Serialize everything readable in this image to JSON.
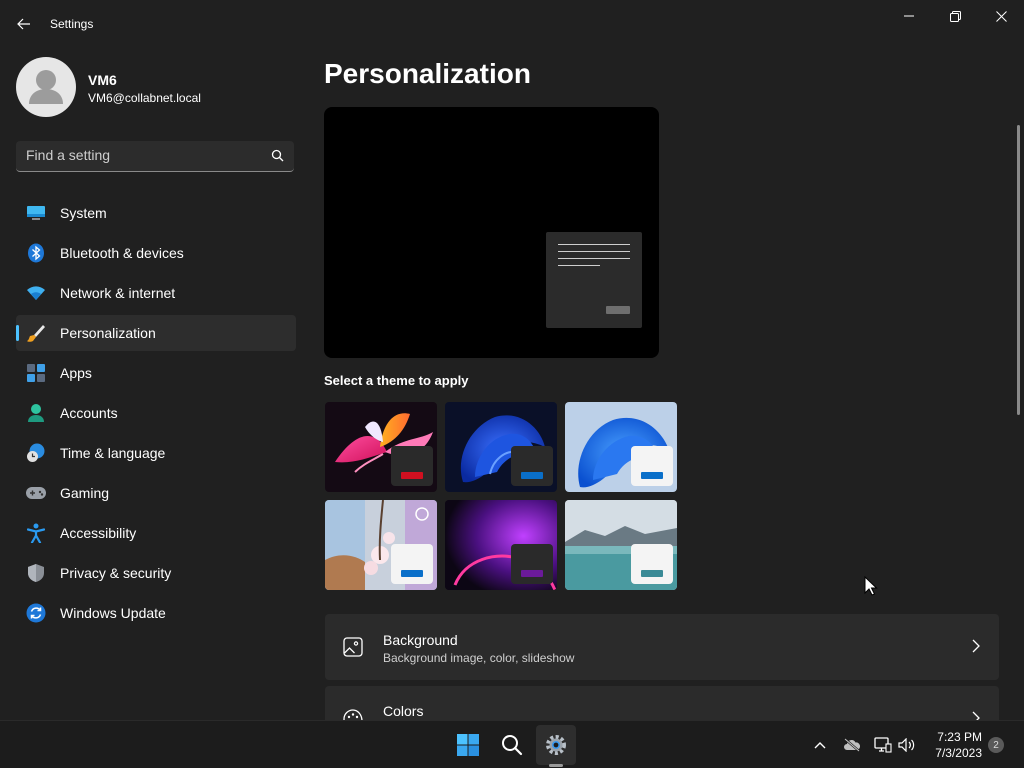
{
  "window": {
    "title": "Settings"
  },
  "profile": {
    "name": "VM6",
    "email": "VM6@collabnet.local"
  },
  "search": {
    "placeholder": "Find a setting"
  },
  "sidebar": {
    "items": [
      {
        "label": "System",
        "icon": "system-icon"
      },
      {
        "label": "Bluetooth & devices",
        "icon": "bluetooth-icon"
      },
      {
        "label": "Network & internet",
        "icon": "wifi-icon"
      },
      {
        "label": "Personalization",
        "icon": "brush-icon",
        "selected": true
      },
      {
        "label": "Apps",
        "icon": "apps-icon"
      },
      {
        "label": "Accounts",
        "icon": "person-icon"
      },
      {
        "label": "Time & language",
        "icon": "globe-clock-icon"
      },
      {
        "label": "Gaming",
        "icon": "gamepad-icon"
      },
      {
        "label": "Accessibility",
        "icon": "accessibility-icon"
      },
      {
        "label": "Privacy & security",
        "icon": "shield-icon"
      },
      {
        "label": "Windows Update",
        "icon": "update-icon"
      }
    ]
  },
  "main": {
    "title": "Personalization",
    "themes_label": "Select a theme to apply",
    "themes": [
      {
        "name": "theme-glow",
        "accent": "#d01020"
      },
      {
        "name": "theme-windows-dark",
        "accent": "#0a6fc9"
      },
      {
        "name": "theme-windows-light",
        "accent": "#0a6fc9"
      },
      {
        "name": "theme-captured-motion",
        "accent": "#0a6fc9"
      },
      {
        "name": "theme-flow",
        "accent": "#6b1a9a"
      },
      {
        "name": "theme-sunrise",
        "accent": "#3a8a96"
      }
    ],
    "cards": [
      {
        "title": "Background",
        "subtitle": "Background image, color, slideshow",
        "icon": "image-icon"
      },
      {
        "title": "Colors",
        "subtitle": "",
        "icon": "palette-icon"
      }
    ]
  },
  "taskbar": {
    "apps": [
      "start-icon",
      "search-icon",
      "settings-icon"
    ],
    "tray": [
      "chevron-up-icon",
      "cloud-offline-icon",
      "network-icon",
      "volume-icon"
    ],
    "time": "7:23 PM",
    "date": "7/3/2023",
    "notifications": "2"
  },
  "colors": {
    "background": "#202020",
    "accent": "#4cc2ff"
  }
}
